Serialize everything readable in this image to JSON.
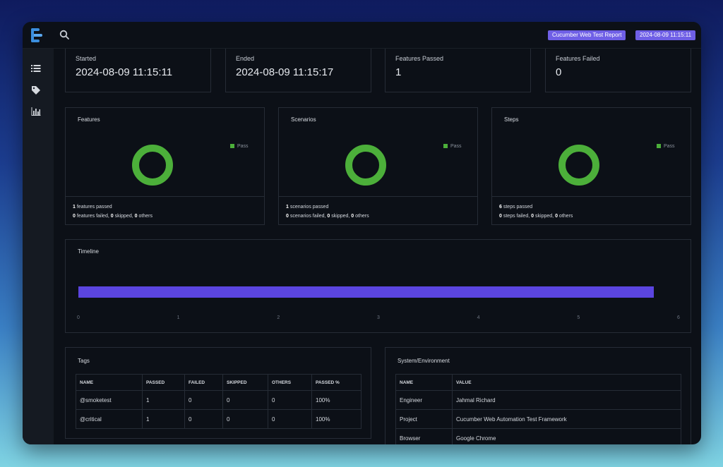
{
  "header": {
    "report_badge": "Cucumber Web Test Report",
    "date_badge": "2024-08-09 11:15:11",
    "accent": "#6f5fe6"
  },
  "sidebar": {
    "items": [
      {
        "icon": "list-icon"
      },
      {
        "icon": "tag-icon"
      },
      {
        "icon": "bar-chart-icon"
      }
    ]
  },
  "stats": [
    {
      "label": "Started",
      "value": "2024-08-09 11:15:11"
    },
    {
      "label": "Ended",
      "value": "2024-08-09 11:15:17"
    },
    {
      "label": "Features Passed",
      "value": "1"
    },
    {
      "label": "Features Failed",
      "value": "0"
    }
  ],
  "panels": [
    {
      "title": "Features",
      "legend": "Pass",
      "passed": 1,
      "passed_text": "features passed",
      "failed": 0,
      "failed_text": "features failed,",
      "skipped": 0,
      "skipped_text": "skipped,",
      "others": 0,
      "others_text": "others"
    },
    {
      "title": "Scenarios",
      "legend": "Pass",
      "passed": 1,
      "passed_text": "scenarios passed",
      "failed": 0,
      "failed_text": "scenarios failed,",
      "skipped": 0,
      "skipped_text": "skipped,",
      "others": 0,
      "others_text": "others"
    },
    {
      "title": "Steps",
      "legend": "Pass",
      "passed": 6,
      "passed_text": "steps passed",
      "failed": 0,
      "failed_text": "steps failed,",
      "skipped": 0,
      "skipped_text": "skipped,",
      "others": 0,
      "others_text": "others"
    }
  ],
  "pass_color": "#4caf3a",
  "timeline": {
    "title": "Timeline",
    "ticks": [
      "0",
      "1",
      "2",
      "3",
      "4",
      "5",
      "6"
    ],
    "bar_start": 0,
    "bar_end": 5.75,
    "bar_color": "#5b45e0"
  },
  "tags": {
    "title": "Tags",
    "columns": [
      "NAME",
      "PASSED",
      "FAILED",
      "SKIPPED",
      "OTHERS",
      "PASSED %"
    ],
    "rows": [
      [
        "@smoketest",
        "1",
        "0",
        "0",
        "0",
        "100%"
      ],
      [
        "@critical",
        "1",
        "0",
        "0",
        "0",
        "100%"
      ]
    ]
  },
  "environment": {
    "title": "System/Environment",
    "columns": [
      "NAME",
      "VALUE"
    ],
    "rows": [
      [
        "Engineer",
        "Jahmal Richard"
      ],
      [
        "Project",
        "Cucumber Web Automation Test Framework"
      ],
      [
        "Browser",
        "Google Chrome"
      ]
    ]
  }
}
